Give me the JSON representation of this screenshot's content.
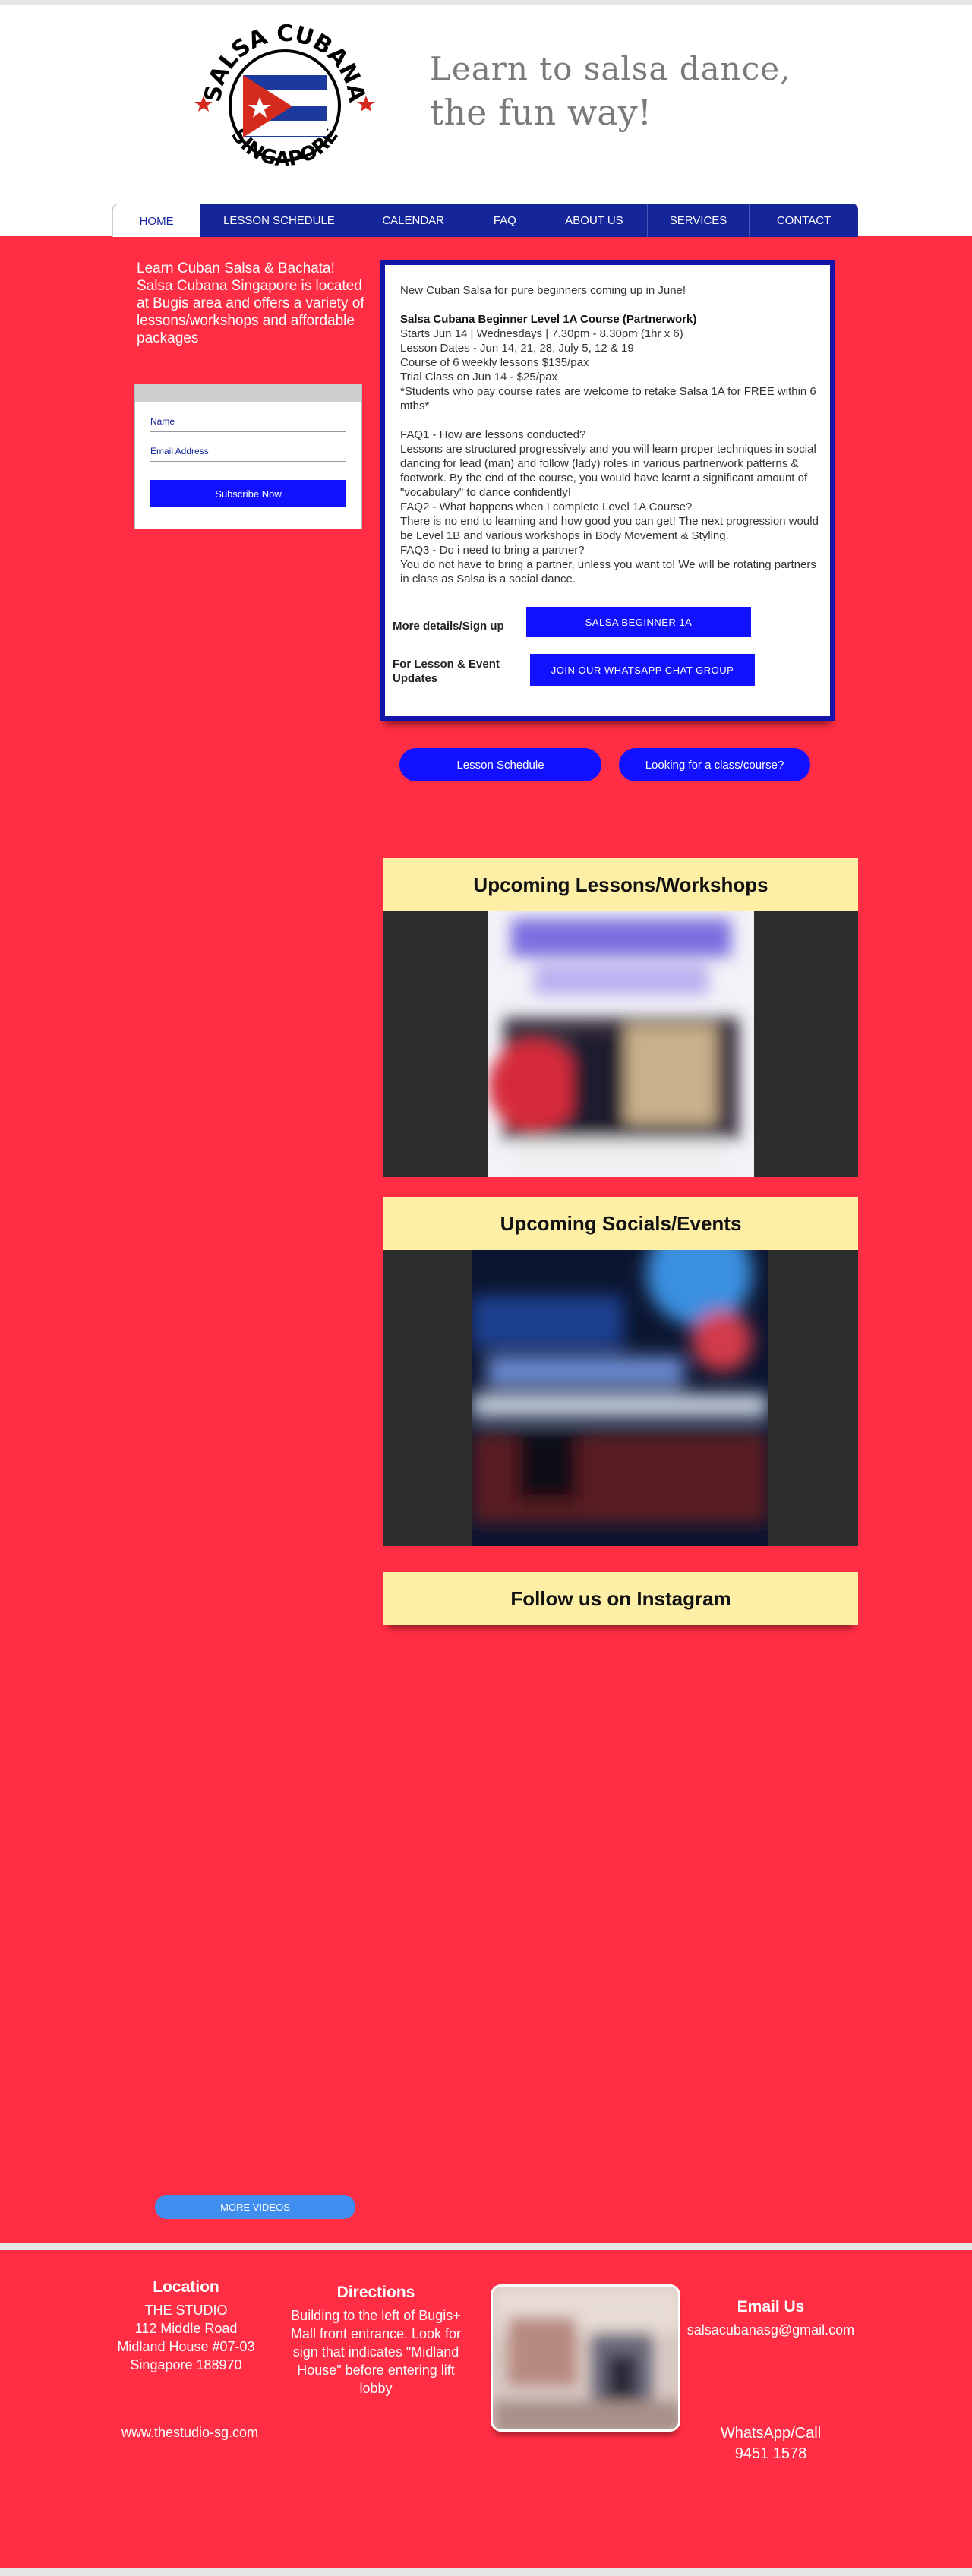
{
  "header": {
    "logo": {
      "text_top": "SALSA CUBANA",
      "text_bottom": "SINGAPORE"
    },
    "tagline_line1": "Learn to salsa dance,",
    "tagline_line2": "the fun way!"
  },
  "nav": {
    "items": [
      {
        "label": "HOME"
      },
      {
        "label": "LESSON SCHEDULE"
      },
      {
        "label": "CALENDAR"
      },
      {
        "label": "FAQ"
      },
      {
        "label": "ABOUT US"
      },
      {
        "label": "SERVICES"
      },
      {
        "label": "CONTACT"
      }
    ]
  },
  "intro": {
    "text": "Learn Cuban Salsa & Bachata! Salsa Cubana Singapore is located at Bugis area and offers a variety of lessons/workshops and affordable packages"
  },
  "subscribe": {
    "name_label": "Name",
    "email_label": "Email Address",
    "button": "Subscribe Now"
  },
  "infobox": {
    "line_intro": "New Cuban Salsa for pure beginners coming up in June!",
    "course_title": "Salsa Cubana Beginner Level 1A Course (Partnerwork)",
    "course_lines": [
      "Starts Jun 14 | Wednesdays | 7.30pm - 8.30pm (1hr x 6)",
      "Lesson Dates - Jun 14, 21, 28, July 5, 12 & 19",
      "Course of 6 weekly lessons $135/pax",
      "Trial Class on Jun 14 - $25/pax",
      "*Students who pay course rates are welcome to retake Salsa 1A for FREE within 6 mths*"
    ],
    "faq_lines": [
      "FAQ1 - How are lessons conducted?",
      "Lessons are structured progressively and you will learn proper techniques in social dancing for lead (man) and follow (lady) roles in various partnerwork patterns & footwork. By the end of the course, you would have learnt a significant amount of \"vocabulary\" to dance confidently!",
      "FAQ2 - What happens when I complete Level 1A Course?",
      "There is no end to learning and how good you can get! The next progression would be Level 1B and various workshops in Body Movement & Styling.",
      "FAQ3 - Do i need to bring a partner?",
      "You do not have to bring a partner, unless you want to! We will be rotating partners in class as Salsa is a social dance."
    ],
    "signup_label": "More details/Sign up",
    "signup_button": "SALSA BEGINNER 1A",
    "updates_label": "For Lesson & Event Updates",
    "updates_button": "JOIN OUR WHATSAPP CHAT GROUP"
  },
  "pills": {
    "schedule": "Lesson Schedule",
    "looking": "Looking for a class/course?"
  },
  "sections": {
    "upcoming_lessons": "Upcoming Lessons/Workshops",
    "upcoming_socials": "Upcoming Socials/Events",
    "follow_instagram": "Follow us on Instagram"
  },
  "more_videos": "MORE VIDEOS",
  "footer": {
    "location_title": "Location",
    "location_lines": [
      "THE STUDIO",
      "112 Middle Road",
      "Midland House #07-03",
      "Singapore 188970"
    ],
    "website": "www.thestudio-sg.com",
    "directions_title": "Directions",
    "directions_text": "Building to the left of Bugis+ Mall front entrance. Look for sign that indicates \"Midland House\" before entering lift lobby",
    "email_title": "Email Us",
    "email": "salsacubanasg@gmail.com",
    "whatsapp_label": "WhatsApp/Call",
    "whatsapp_number": "9451 1578"
  },
  "colors": {
    "page_bg": "#ff2e44",
    "nav_bg": "#15259a",
    "button_blue": "#1111ff",
    "section_header": "#fdefa6",
    "more_videos": "#3f8ef0"
  },
  "icons": {
    "logo": "cuban-flag-logo"
  }
}
